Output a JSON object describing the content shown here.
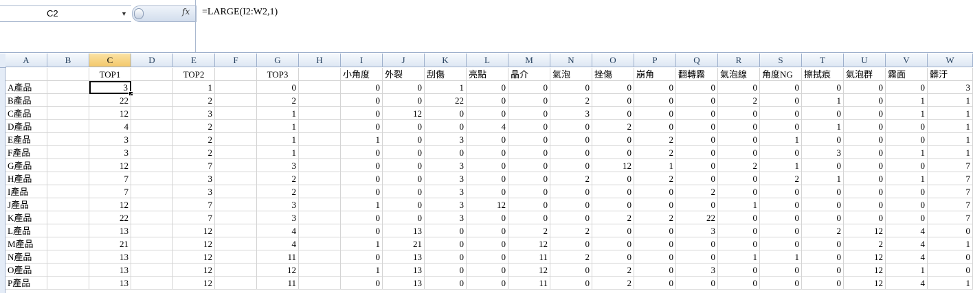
{
  "formula_bar": {
    "name_box": "C2",
    "fx_label": "fx",
    "formula": "=LARGE(I2:W2,1)"
  },
  "columns": [
    "A",
    "B",
    "C",
    "D",
    "E",
    "F",
    "G",
    "H",
    "I",
    "J",
    "K",
    "L",
    "M",
    "N",
    "O",
    "P",
    "Q",
    "R",
    "S",
    "T",
    "U",
    "V",
    "W"
  ],
  "selected_cell": "C2",
  "header_row": [
    "",
    "",
    "TOP1",
    "",
    "TOP2",
    "",
    "TOP3",
    "",
    "小角度",
    "外裂",
    "刮傷",
    "亮點",
    "晶介",
    "氣泡",
    "挫傷",
    "崩角",
    "翻轉霧",
    "氣泡線",
    "角度NG",
    "擦拭痕",
    "氣泡群",
    "霧面",
    "髒汙"
  ],
  "rows": [
    {
      "label": "A產品",
      "top1": 3,
      "top2": 1,
      "top3": 0,
      "values": [
        0,
        0,
        1,
        0,
        0,
        0,
        0,
        0,
        0,
        0,
        0,
        0,
        0,
        0,
        3
      ]
    },
    {
      "label": "B產品",
      "top1": 22,
      "top2": 2,
      "top3": 2,
      "values": [
        0,
        0,
        22,
        0,
        0,
        2,
        0,
        0,
        0,
        2,
        0,
        1,
        0,
        1,
        1
      ]
    },
    {
      "label": "C產品",
      "top1": 12,
      "top2": 3,
      "top3": 1,
      "values": [
        0,
        12,
        0,
        0,
        0,
        3,
        0,
        0,
        0,
        0,
        0,
        0,
        0,
        1,
        1
      ]
    },
    {
      "label": "D產品",
      "top1": 4,
      "top2": 2,
      "top3": 1,
      "values": [
        0,
        0,
        0,
        4,
        0,
        0,
        2,
        0,
        0,
        0,
        0,
        1,
        0,
        0,
        1
      ]
    },
    {
      "label": "E產品",
      "top1": 3,
      "top2": 2,
      "top3": 1,
      "values": [
        1,
        0,
        3,
        0,
        0,
        0,
        0,
        2,
        0,
        0,
        1,
        0,
        0,
        0,
        1
      ]
    },
    {
      "label": "F產品",
      "top1": 3,
      "top2": 2,
      "top3": 1,
      "values": [
        0,
        0,
        0,
        0,
        0,
        0,
        0,
        2,
        0,
        0,
        0,
        3,
        0,
        1,
        1
      ]
    },
    {
      "label": "G產品",
      "top1": 12,
      "top2": 7,
      "top3": 3,
      "values": [
        0,
        0,
        3,
        0,
        0,
        0,
        12,
        1,
        0,
        2,
        1,
        0,
        0,
        0,
        7
      ]
    },
    {
      "label": "H產品",
      "top1": 7,
      "top2": 3,
      "top3": 2,
      "values": [
        0,
        0,
        3,
        0,
        0,
        2,
        0,
        2,
        0,
        0,
        2,
        1,
        0,
        1,
        7
      ]
    },
    {
      "label": "I產品",
      "top1": 7,
      "top2": 3,
      "top3": 2,
      "values": [
        0,
        0,
        3,
        0,
        0,
        0,
        0,
        0,
        2,
        0,
        0,
        0,
        0,
        0,
        7
      ]
    },
    {
      "label": "J產品",
      "top1": 12,
      "top2": 7,
      "top3": 3,
      "values": [
        1,
        0,
        3,
        12,
        0,
        0,
        0,
        0,
        0,
        1,
        0,
        0,
        0,
        0,
        7
      ]
    },
    {
      "label": "K產品",
      "top1": 22,
      "top2": 7,
      "top3": 3,
      "values": [
        0,
        0,
        3,
        0,
        0,
        0,
        2,
        2,
        22,
        0,
        0,
        0,
        0,
        0,
        7
      ]
    },
    {
      "label": "L產品",
      "top1": 13,
      "top2": 12,
      "top3": 4,
      "values": [
        0,
        13,
        0,
        0,
        2,
        2,
        0,
        0,
        3,
        0,
        0,
        2,
        12,
        4,
        0
      ]
    },
    {
      "label": "M產品",
      "top1": 21,
      "top2": 12,
      "top3": 4,
      "values": [
        1,
        21,
        0,
        0,
        12,
        0,
        0,
        0,
        0,
        0,
        0,
        0,
        2,
        4,
        1
      ]
    },
    {
      "label": "N產品",
      "top1": 13,
      "top2": 12,
      "top3": 11,
      "values": [
        0,
        13,
        0,
        0,
        11,
        2,
        0,
        0,
        0,
        1,
        1,
        0,
        12,
        4,
        0
      ]
    },
    {
      "label": "O產品",
      "top1": 13,
      "top2": 12,
      "top3": 12,
      "values": [
        1,
        13,
        0,
        0,
        12,
        0,
        2,
        0,
        3,
        0,
        0,
        0,
        12,
        1,
        0
      ]
    },
    {
      "label": "P產品",
      "top1": 13,
      "top2": 12,
      "top3": 11,
      "values": [
        0,
        13,
        0,
        0,
        11,
        0,
        2,
        0,
        0,
        0,
        0,
        0,
        12,
        4,
        1
      ]
    }
  ]
}
